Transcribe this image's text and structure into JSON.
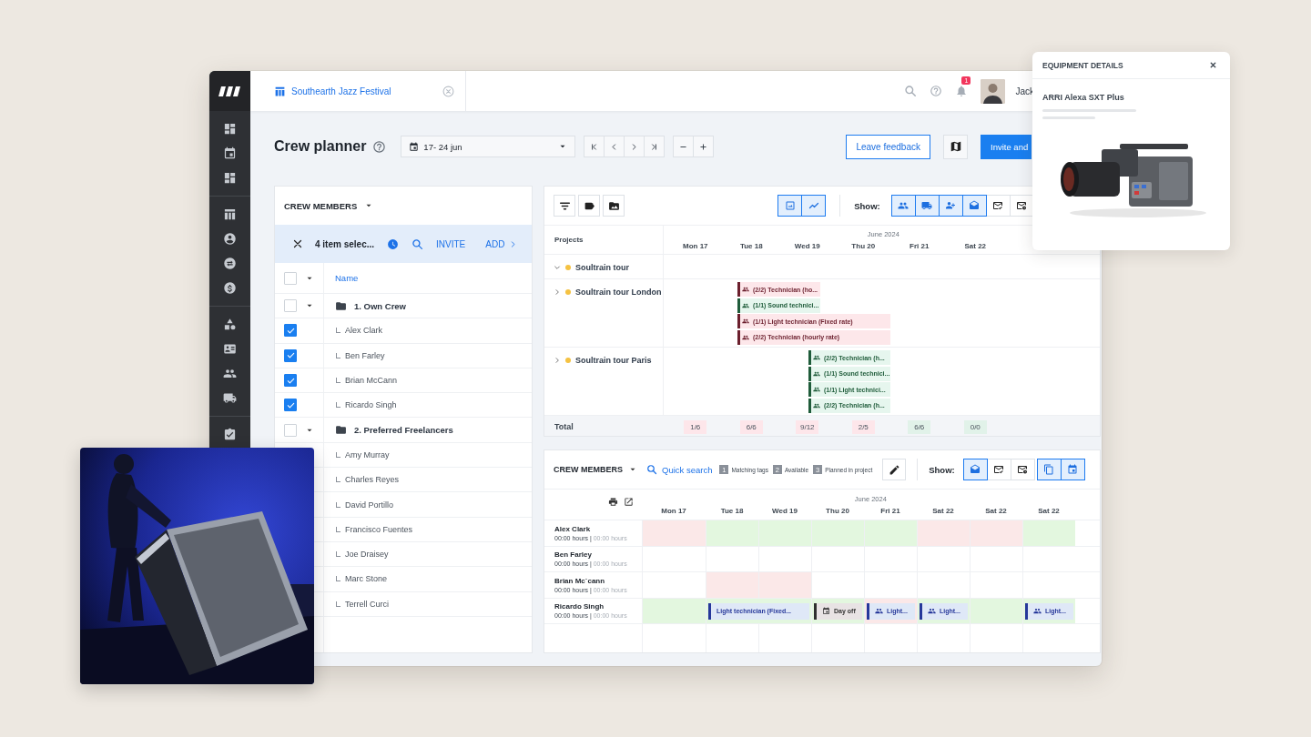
{
  "topbar": {
    "tab": "Southearth Jazz Festival",
    "notifications": "1",
    "user": "Jack"
  },
  "page": {
    "title": "Crew planner",
    "date_range": "17- 24 jun",
    "feedback_button": "Leave feedback",
    "invite_button": "Invite and"
  },
  "crew_panel": {
    "title": "CREW MEMBERS",
    "selection": "4 item selec...",
    "actions": [
      "INVITE",
      "ADD"
    ],
    "column": "Name",
    "all_checked": false,
    "groups": [
      {
        "label": "1. Own Crew",
        "checked": false,
        "expanded": true,
        "children": [
          {
            "name": "Alex Clark",
            "checked": true
          },
          {
            "name": "Ben Farley",
            "checked": true
          },
          {
            "name": "Brian McCann",
            "checked": true
          },
          {
            "name": "Ricardo Singh",
            "checked": true
          }
        ]
      },
      {
        "label": "2. Preferred Freelancers",
        "checked": false,
        "expanded": true,
        "children": [
          {
            "name": "Amy Murray"
          },
          {
            "name": "Charles Reyes"
          },
          {
            "name": "David Portillo"
          },
          {
            "name": "Francisco Fuentes"
          },
          {
            "name": "Joe Draisey"
          },
          {
            "name": "Marc Stone"
          },
          {
            "name": "Terrell Curci"
          }
        ]
      }
    ]
  },
  "project_planner": {
    "view_toggles": [
      {
        "selected": true
      },
      {
        "selected": true
      }
    ],
    "show_label": "Show:",
    "show_toggles": [
      {
        "selected": true
      },
      {
        "selected": true
      },
      {
        "selected": true
      },
      {
        "selected": true
      },
      {
        "selected": false
      },
      {
        "selected": false
      }
    ],
    "projects_label": "Projects",
    "month": "June 2024",
    "days": [
      "Mon 17",
      "Tue 18",
      "Wed 19",
      "Thu 20",
      "Fri 21",
      "Sat 22"
    ],
    "rows": [
      {
        "name": "Soultrain tour",
        "expanded": true
      },
      {
        "name": "Soultrain tour London",
        "expanded": false,
        "bars": [
          {
            "label": "(2/2) Technician (ho...",
            "color": "#6b1f2d"
          },
          {
            "label": "(1/1) Sound technici...",
            "color": "#1f5c3a"
          },
          {
            "label": "(1/1) Light technician (Fixed rate)",
            "color": "#6b1f2d"
          },
          {
            "label": "(2/2) Technician (hourly rate)",
            "color": "#6b1f2d"
          }
        ]
      },
      {
        "name": "Soultrain tour Paris",
        "expanded": false,
        "bars": [
          {
            "label": "(2/2) Technician (h...",
            "color": "#1f5c3a"
          },
          {
            "label": "(1/1) Sound technici...",
            "color": "#1f5c3a"
          },
          {
            "label": "(1/1) Light technici...",
            "color": "#1f5c3a"
          },
          {
            "label": "(2/2) Technician (h...",
            "color": "#1f5c3a"
          }
        ]
      }
    ],
    "total_label": "Total",
    "totals": [
      {
        "text": "1/6",
        "color": "#fde6ea"
      },
      {
        "text": "6/6",
        "color": "#fde6ea"
      },
      {
        "text": "9/12",
        "color": "#fde6ea"
      },
      {
        "text": "2/5",
        "color": "#fde6ea"
      },
      {
        "text": "6/6",
        "color": "#e1f2e9"
      },
      {
        "text": "0/0",
        "color": "#e1f2e9"
      }
    ]
  },
  "crew_planner": {
    "title": "CREW MEMBERS",
    "search": "Quick search",
    "legend": [
      {
        "number": "1",
        "label": "Matching tags"
      },
      {
        "number": "2",
        "label": "Available"
      },
      {
        "number": "3",
        "label": "Planned in project"
      }
    ],
    "show_label": "Show:",
    "show_toggles": [
      {
        "selected": true
      },
      {
        "selected": false
      },
      {
        "selected": false
      },
      {
        "selected": true
      },
      {
        "selected": true
      }
    ],
    "month": "June 2024",
    "days": [
      "Mon 17",
      "Tue 18",
      "Wed 19",
      "Thu 20",
      "Fri 21",
      "Sat 22",
      "Sat 22",
      "Sat 22"
    ],
    "members": [
      {
        "name": "Alex Clark",
        "hours": "00:00 hours |",
        "planned_hours": "00:00 hours",
        "cells": [
          {
            "color": "#fbe8e8"
          },
          {
            "color": "#e3f7df"
          },
          {
            "color": "#e3f7df"
          },
          {
            "color": "#e3f7df"
          },
          {
            "color": "#e3f7df"
          },
          {
            "color": "#fbe8e8"
          },
          {
            "color": "#fbe8e8"
          },
          {
            "color": "#e3f7df"
          }
        ]
      },
      {
        "name": "Ben Farley",
        "hours": "00:00 hours |",
        "planned_hours": "00:00 hours",
        "cells": [
          {
            "color": "#ffffff"
          },
          {
            "color": "#ffffff"
          },
          {
            "color": "#ffffff"
          },
          {
            "color": "#ffffff"
          },
          {
            "color": "#ffffff"
          },
          {
            "color": "#ffffff"
          },
          {
            "color": "#ffffff"
          },
          {
            "color": "#ffffff"
          }
        ]
      },
      {
        "name": "Brian Mc`cann",
        "hours": "00:00 hours |",
        "planned_hours": "00:00 hours",
        "cells": [
          {
            "color": "#ffffff"
          },
          {
            "color": "#fbe8e8"
          },
          {
            "color": "#fbe8e8"
          },
          {
            "color": "#ffffff"
          },
          {
            "color": "#ffffff"
          },
          {
            "color": "#ffffff"
          },
          {
            "color": "#ffffff"
          },
          {
            "color": "#ffffff"
          }
        ]
      },
      {
        "name": "Ricardo Singh",
        "hours": "00:00 hours |",
        "planned_hours": "00:00 hours",
        "cells": [
          {
            "color": "#e3f7df"
          },
          {
            "color": "#e3f7df"
          },
          {
            "color": "#e3f7df"
          },
          {
            "color": "#e3f7df"
          },
          {
            "color": "#fbe8e8"
          },
          {
            "color": "#e3f7df"
          },
          {
            "color": "#e3f7df"
          },
          {
            "color": "#e3f7df"
          }
        ],
        "events": [
          {
            "kind": "task",
            "label": "Light technician (Fixed..."
          },
          {
            "kind": "day-off",
            "label": "Day off"
          },
          {
            "kind": "crew",
            "label": "Light..."
          },
          {
            "kind": "crew",
            "label": "Light..."
          },
          {
            "kind": "crew",
            "label": "Light..."
          }
        ]
      }
    ]
  },
  "equipment_details": {
    "title": "EQUIPMENT DETAILS",
    "name": "ARRI Alexa SXT Plus"
  }
}
